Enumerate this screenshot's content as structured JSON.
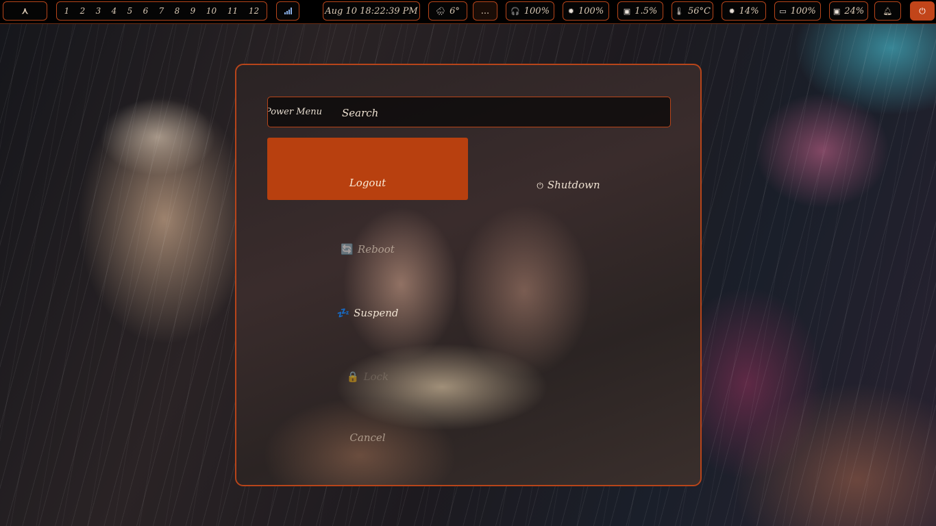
{
  "topbar": {
    "launcher_icon": "arch-icon",
    "workspaces": [
      "1",
      "2",
      "3",
      "4",
      "5",
      "6",
      "7",
      "8",
      "9",
      "10",
      "11",
      "12"
    ],
    "signal_icon": "signal-bars-icon",
    "clock": "Aug 10 18:22:39 PM",
    "weather": {
      "icon": "rain-cloud-icon",
      "value": "6°"
    },
    "tray_label": "...",
    "headphones": {
      "icon": "headphones-icon",
      "value": "100%"
    },
    "brightness": {
      "icon": "sun-icon",
      "value": "100%"
    },
    "cpu": {
      "icon": "cpu-icon",
      "value": "1.5%"
    },
    "temperature": {
      "icon": "thermometer-icon",
      "value": "56°C"
    },
    "memory": {
      "icon": "memory-icon",
      "value": "14%"
    },
    "battery": {
      "icon": "battery-icon",
      "value": "100%"
    },
    "disk": {
      "icon": "disk-icon",
      "value": "24%"
    },
    "notification_icon": "bell-icon",
    "power_icon": "power-icon"
  },
  "menu": {
    "prompt": "Power Menu",
    "search_placeholder": "Search",
    "entries": [
      {
        "label": "Logout",
        "icon": "",
        "selected": true
      },
      {
        "label": "Shutdown",
        "icon": "⏻"
      },
      {
        "label": "Reboot",
        "icon": "🔄"
      },
      {
        "label": "Suspend",
        "icon": "💤"
      },
      {
        "label": "Lock",
        "icon": "🔒"
      },
      {
        "label": "Cancel",
        "icon": ""
      }
    ]
  },
  "colors": {
    "accent": "#b8451a",
    "selected_bg": "#b8400f",
    "text": "#efe2d2"
  }
}
